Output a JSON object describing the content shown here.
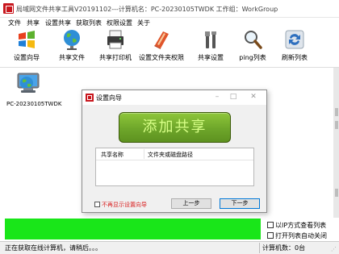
{
  "window": {
    "title": "局域网文件共享工具V20191102---计算机名：PC-20230105TWDK  工作组：WorkGroup"
  },
  "menu": [
    "文件",
    "共享",
    "设置共享",
    "获取列表",
    "权限设置",
    "关于"
  ],
  "toolbar": [
    {
      "label": "设置向导",
      "icon": "windows-logo-icon"
    },
    {
      "label": "共享文件",
      "icon": "globe-icon"
    },
    {
      "label": "共享打印机",
      "icon": "printer-icon"
    },
    {
      "label": "设置文件夹权限",
      "icon": "book-icon"
    },
    {
      "label": "共享设置",
      "icon": "tools-icon"
    },
    {
      "label": "ping列表",
      "icon": "magnifier-icon"
    },
    {
      "label": "刷新列表",
      "icon": "refresh-icon"
    }
  ],
  "computers": [
    {
      "name": "PC-20230105TWDK",
      "icon": "network-computer-icon"
    }
  ],
  "dialog": {
    "title": "设置向导",
    "add_button": "添加共享",
    "columns": [
      "共享名称",
      "文件夹或磁盘路径"
    ],
    "checkbox": "不再显示设置向导",
    "prev_button": "上一步",
    "next_button": "下一步"
  },
  "options": {
    "ip_view": "以IP方式查看列表",
    "auto_refresh": "打开列表自动关闭"
  },
  "status": {
    "message": "正在获取在线计算机，请稍后。。。",
    "count": "计算机数：0台"
  },
  "colors": {
    "progress": "#19e619",
    "add_button": "#6ea62a",
    "app_icon": "#c8171e",
    "dialog_checkbox_text": "#d92020"
  }
}
